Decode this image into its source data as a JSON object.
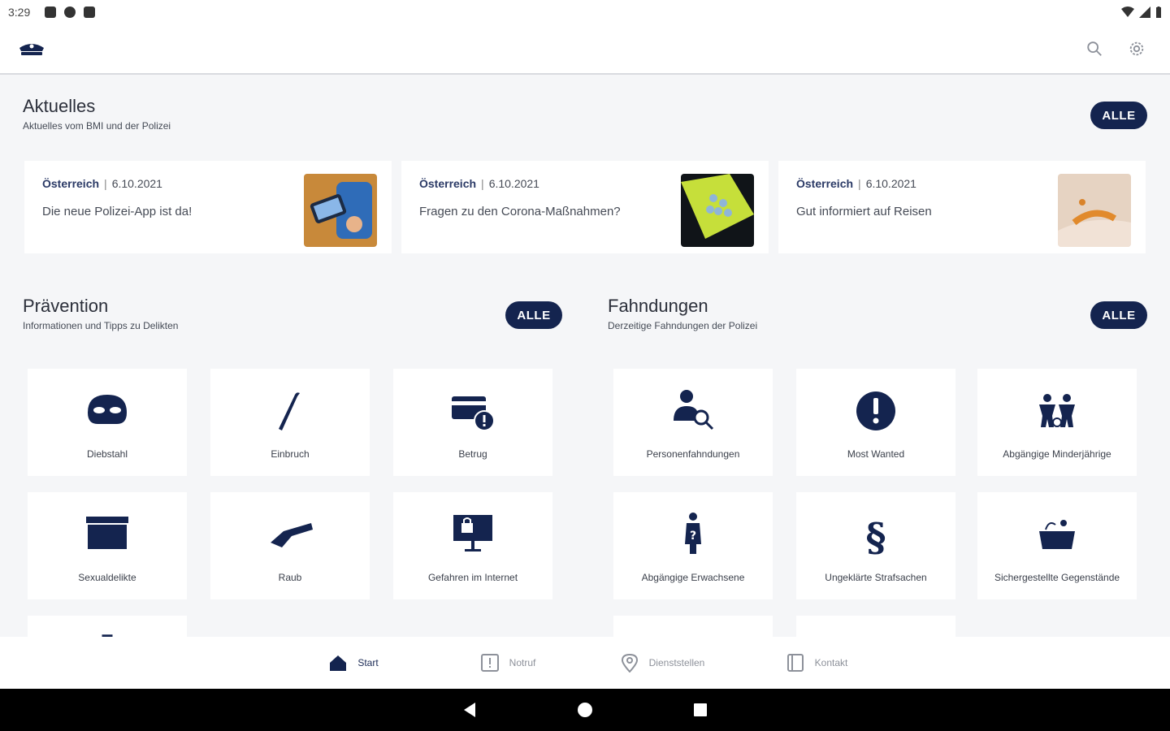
{
  "status": {
    "time": "3:29"
  },
  "colors": {
    "primary": "#14244f",
    "background": "#f5f6f8",
    "card": "#ffffff"
  },
  "toolbar": {
    "logo_icon": "police-cap-icon",
    "search_icon": "search-icon",
    "settings_icon": "gear-icon"
  },
  "aktuelles": {
    "title": "Aktuelles",
    "subtitle": "Aktuelles vom BMI und der Polizei",
    "all_label": "ALLE",
    "cards": [
      {
        "source": "Österreich",
        "date": "6.10.2021",
        "headline": "Die neue Polizei-App ist da!"
      },
      {
        "source": "Österreich",
        "date": "6.10.2021",
        "headline": "Fragen zu den Corona-Maßnahmen?"
      },
      {
        "source": "Österreich",
        "date": "6.10.2021",
        "headline": "Gut informiert auf Reisen"
      }
    ]
  },
  "praevention": {
    "title": "Prävention",
    "subtitle": "Informationen und Tipps zu Delikten",
    "all_label": "ALLE",
    "tiles": [
      {
        "label": "Diebstahl",
        "icon": "mask-icon"
      },
      {
        "label": "Einbruch",
        "icon": "crowbar-icon"
      },
      {
        "label": "Betrug",
        "icon": "card-warning-icon"
      },
      {
        "label": "Sexualdelikte",
        "icon": "box-icon"
      },
      {
        "label": "Raub",
        "icon": "gun-icon"
      },
      {
        "label": "Gefahren im Internet",
        "icon": "monitor-lock-icon"
      }
    ]
  },
  "fahndungen": {
    "title": "Fahndungen",
    "subtitle": "Derzeitige Fahndungen der Polizei",
    "all_label": "ALLE",
    "tiles": [
      {
        "label": "Personenfahndungen",
        "icon": "person-search-icon"
      },
      {
        "label": "Most Wanted",
        "icon": "exclamation-circle-icon"
      },
      {
        "label": "Abgängige Minderjährige",
        "icon": "children-icon"
      },
      {
        "label": "Abgängige Erwachsene",
        "icon": "person-question-icon"
      },
      {
        "label": "Ungeklärte Strafsachen",
        "icon": "paragraph-icon"
      },
      {
        "label": "Sichergestellte Gegenstände",
        "icon": "basket-icon"
      }
    ]
  },
  "bottom_nav": [
    {
      "label": "Start",
      "icon": "home-icon"
    },
    {
      "label": "Notruf",
      "icon": "alert-box-icon"
    },
    {
      "label": "Dienststellen",
      "icon": "location-pin-icon"
    },
    {
      "label": "Kontakt",
      "icon": "contacts-book-icon"
    }
  ]
}
